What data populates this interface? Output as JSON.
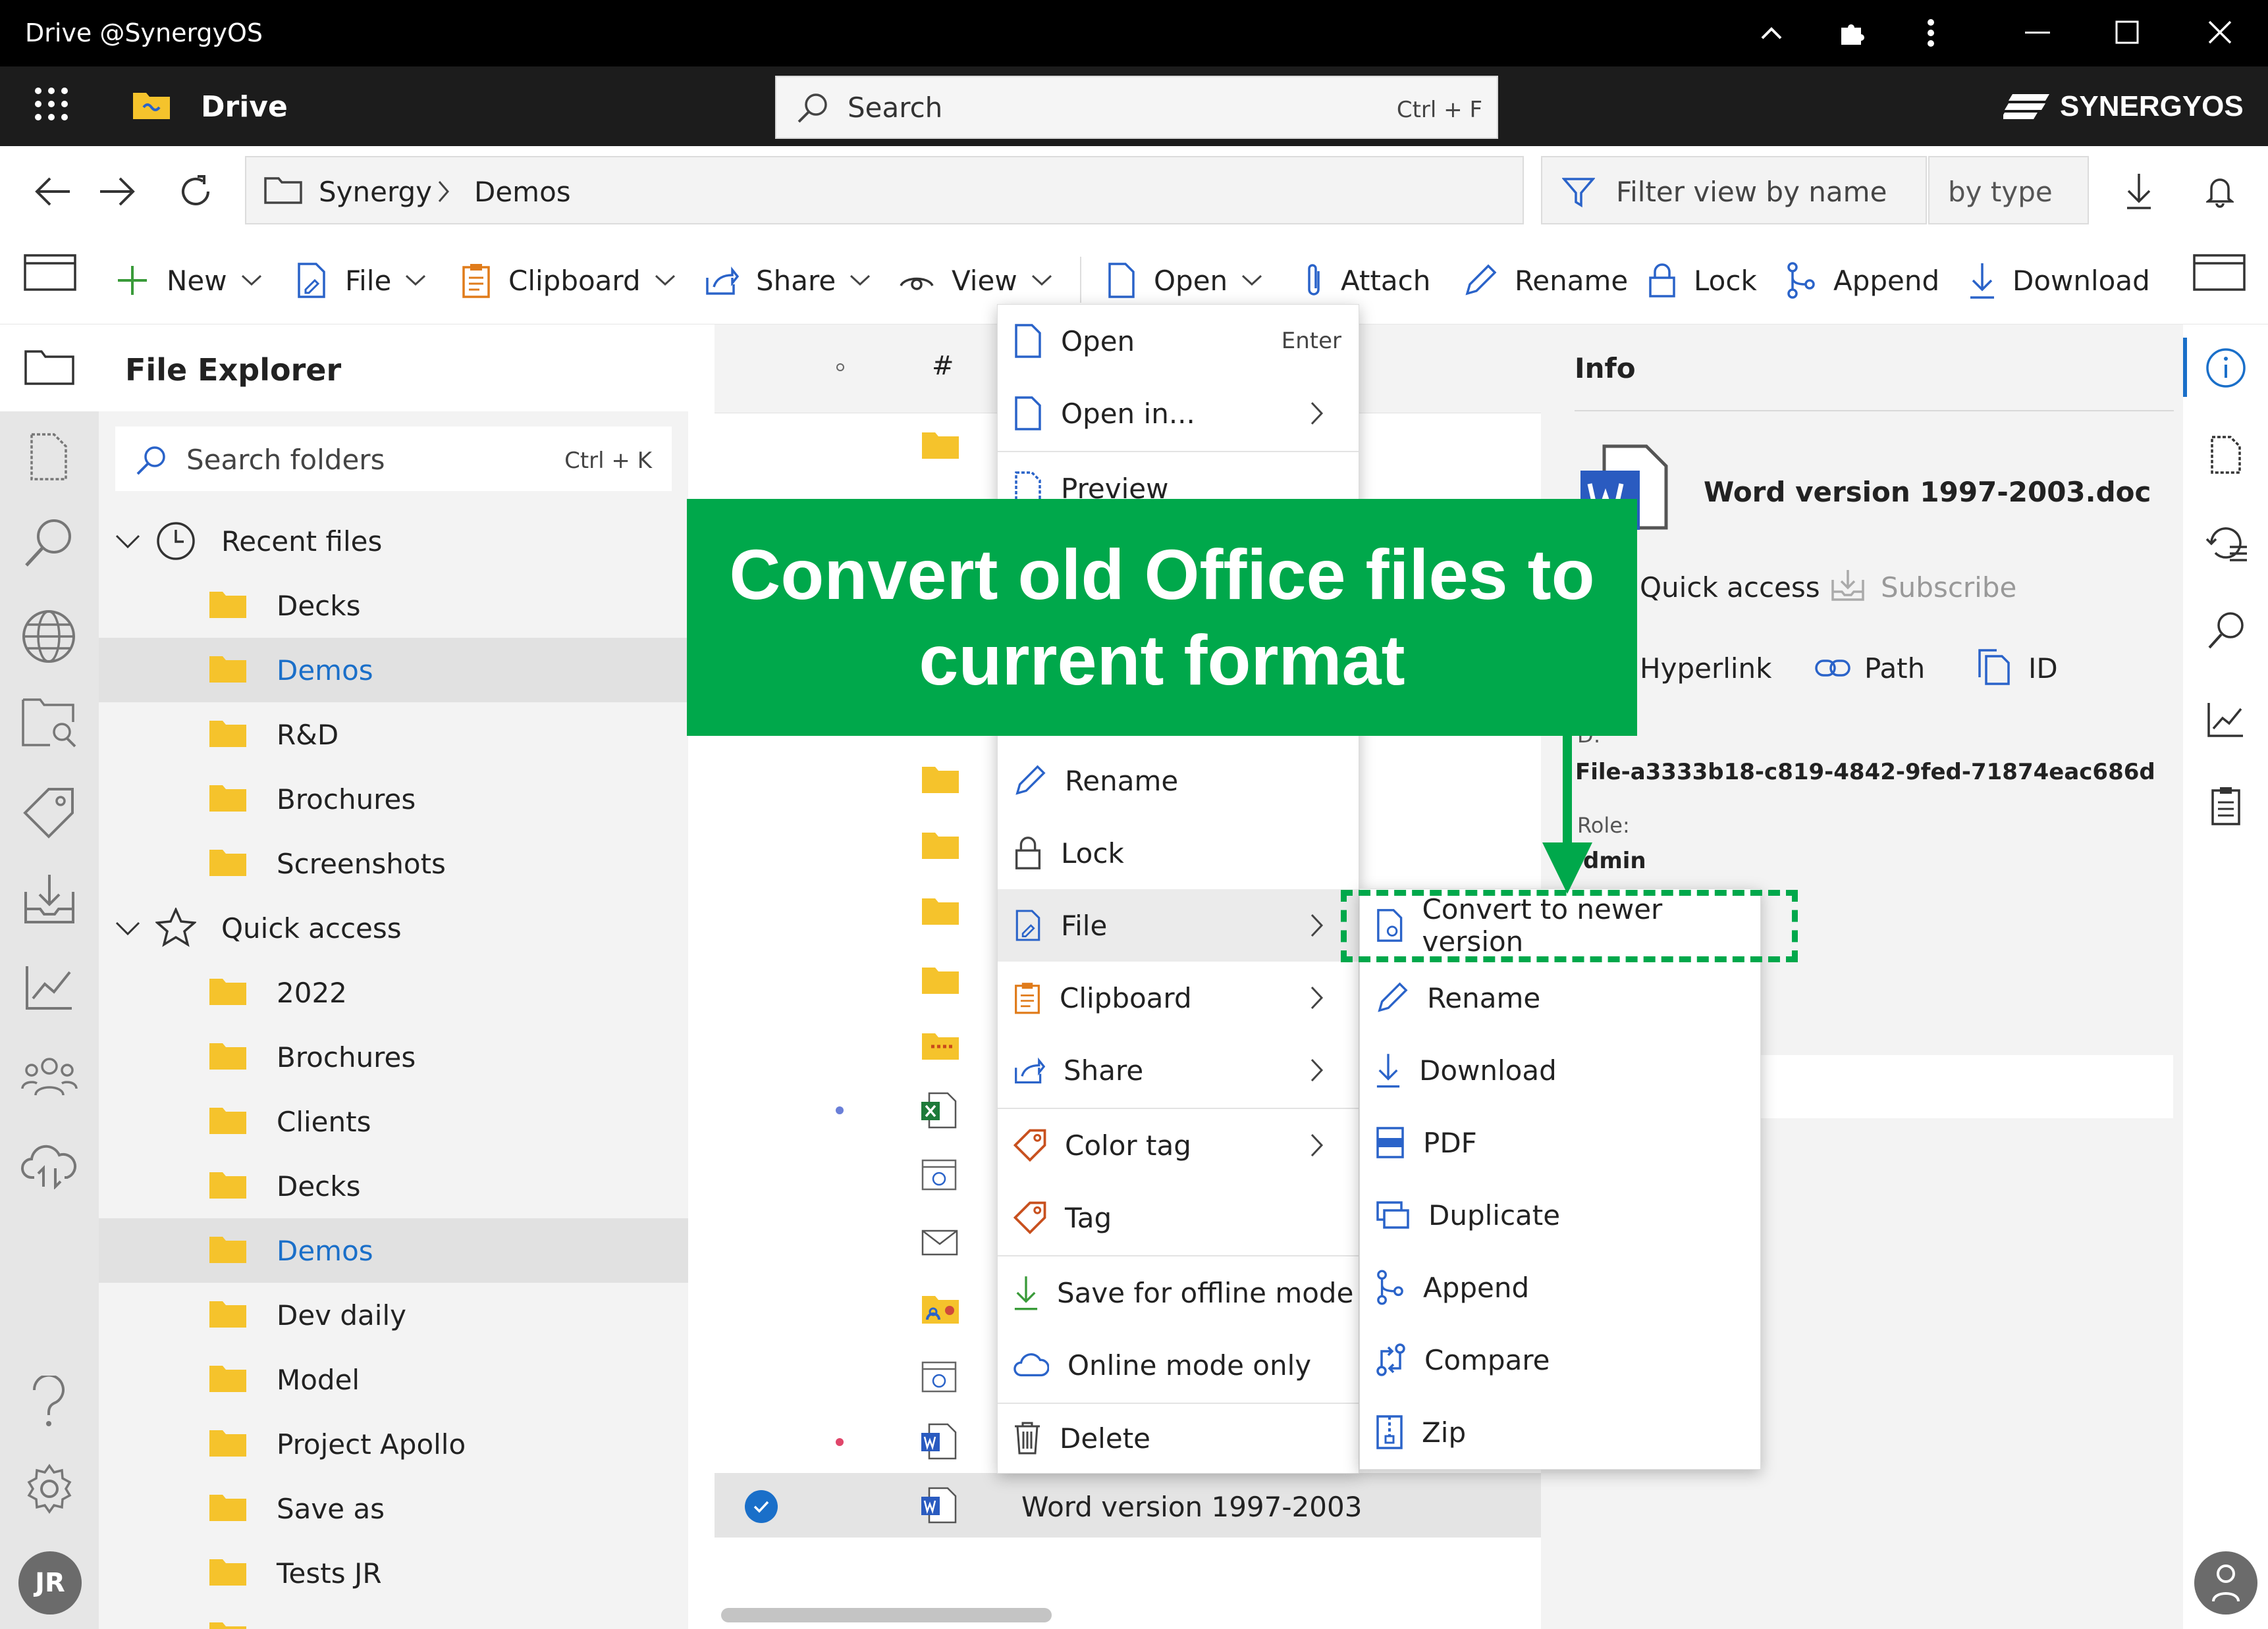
{
  "window": {
    "title": "Drive @SynergyOS"
  },
  "appbar": {
    "app_name": "Drive",
    "search_placeholder": "Search",
    "search_shortcut": "Ctrl + F",
    "brand": "SYNERGYOS"
  },
  "breadcrumb": [
    "Synergy",
    "Demos"
  ],
  "filter": {
    "placeholder": "Filter view by name",
    "by_type": "by type"
  },
  "toolbar": {
    "new": "New",
    "file": "File",
    "clipboard": "Clipboard",
    "share": "Share",
    "view": "View",
    "open": "Open",
    "attach": "Attach",
    "rename": "Rename",
    "lock": "Lock",
    "append": "Append",
    "download": "Download"
  },
  "explorer": {
    "title": "File Explorer",
    "search_placeholder": "Search folders",
    "search_shortcut": "Ctrl + K",
    "recent_label": "Recent files",
    "recent": [
      "Decks",
      "Demos",
      "R&D",
      "Brochures",
      "Screenshots"
    ],
    "quick_label": "Quick access",
    "quick": [
      "2022",
      "Brochures",
      "Clients",
      "Decks",
      "Demos",
      "Dev daily",
      "Model",
      "Project Apollo",
      "Save as",
      "Tests JR"
    ]
  },
  "filelist": {
    "col_hash": "#",
    "selected_name": "Word version 1997-2003"
  },
  "context_menu": {
    "open": "Open",
    "open_shortcut": "Enter",
    "open_in": "Open in...",
    "preview": "Preview",
    "rename": "Rename",
    "lock": "Lock",
    "file": "File",
    "clipboard": "Clipboard",
    "share": "Share",
    "color_tag": "Color tag",
    "tag": "Tag",
    "save_offline": "Save for offline mode",
    "online_only": "Online mode only",
    "delete": "Delete"
  },
  "submenu": {
    "convert": "Convert to newer version",
    "rename": "Rename",
    "download": "Download",
    "pdf": "PDF",
    "duplicate": "Duplicate",
    "append": "Append",
    "compare": "Compare",
    "zip": "Zip"
  },
  "info": {
    "title": "Info",
    "filename": "Word version 1997-2003.doc",
    "quick_access": "Quick access",
    "subscribe": "Subscribe",
    "hyperlink": "Hyperlink",
    "path": "Path",
    "id_btn": "ID",
    "id_label": "D:",
    "id_value": "File-a3333b18-c819-4842-9fed-71874eac686d",
    "role_label": "Role:",
    "role_value": "dmin"
  },
  "user": {
    "initials": "JR"
  },
  "banner": {
    "line1": "Convert old Office files to",
    "line2": "current format"
  },
  "colors": {
    "accent_green": "#00a84b",
    "selection_blue": "#1a6fc9",
    "folder_yellow": "#f5c32c"
  }
}
